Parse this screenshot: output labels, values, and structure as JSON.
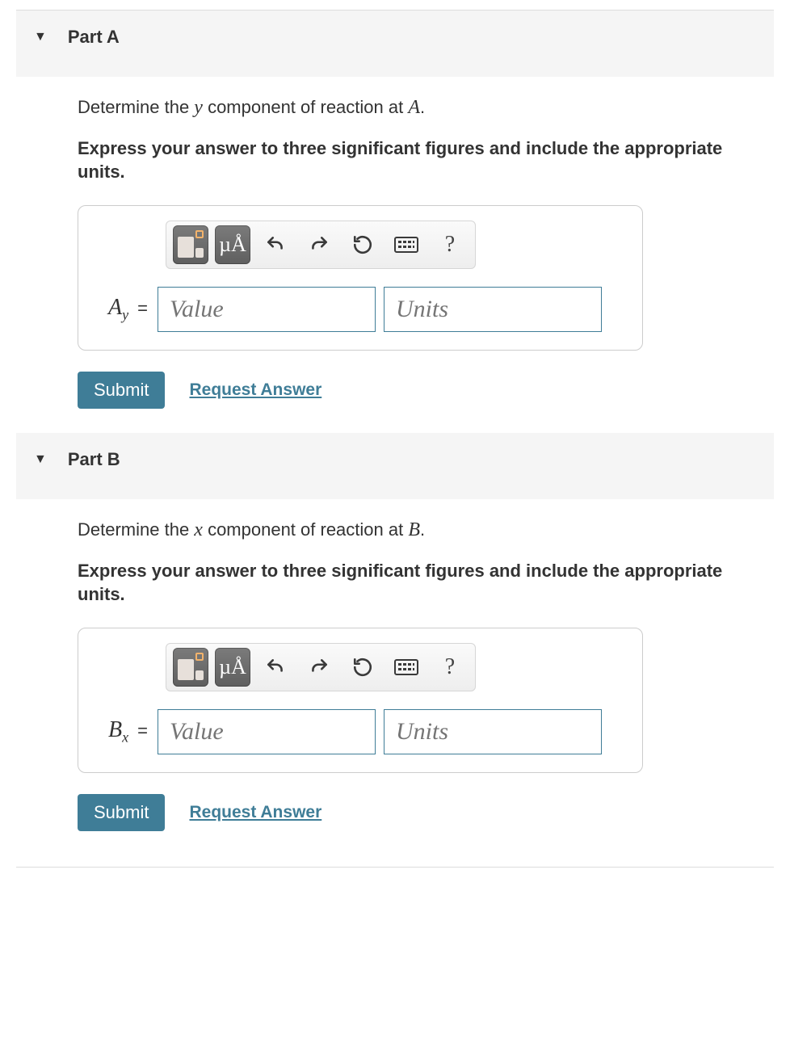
{
  "parts": [
    {
      "title": "Part A",
      "prompt_pre": "Determine the ",
      "prompt_var": "y",
      "prompt_mid": " component of reaction at ",
      "prompt_point": "A",
      "prompt_post": ".",
      "instruction": "Express your answer to three significant figures and include the appropriate units.",
      "var_main": "A",
      "var_sub": "y",
      "value_placeholder": "Value",
      "units_placeholder": "Units",
      "submit_label": "Submit",
      "request_label": "Request Answer",
      "toolbar": {
        "mu_label": "µÅ",
        "help_label": "?"
      }
    },
    {
      "title": "Part B",
      "prompt_pre": "Determine the ",
      "prompt_var": "x",
      "prompt_mid": " component of reaction at ",
      "prompt_point": "B",
      "prompt_post": ".",
      "instruction": "Express your answer to three significant figures and include the appropriate units.",
      "var_main": "B",
      "var_sub": "x",
      "value_placeholder": "Value",
      "units_placeholder": "Units",
      "submit_label": "Submit",
      "request_label": "Request Answer",
      "toolbar": {
        "mu_label": "µÅ",
        "help_label": "?"
      }
    }
  ]
}
